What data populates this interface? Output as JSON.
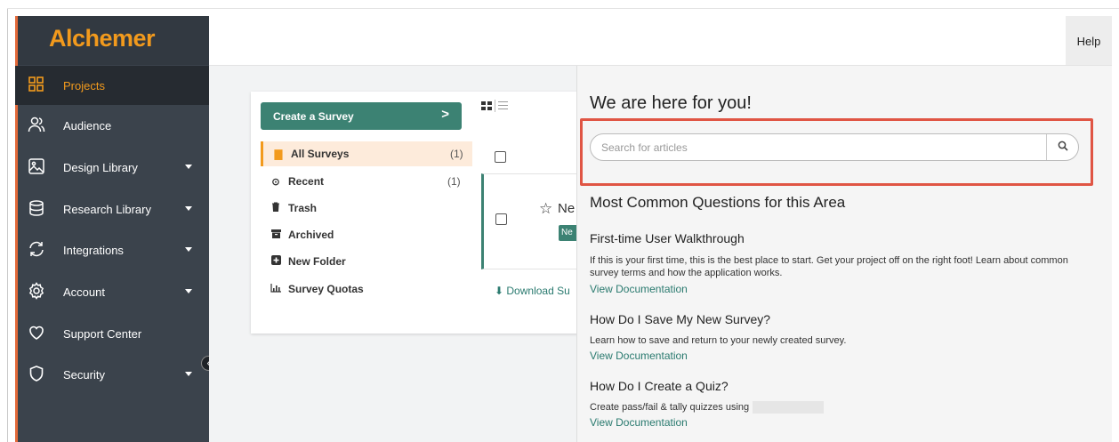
{
  "brand": {
    "logo_text": "Alchemer",
    "accent_color": "#f29a1d",
    "sidebar_color": "#3b434c",
    "primary_green": "#3c8273",
    "highlight_red": "#e05544"
  },
  "sidebar": {
    "items": [
      {
        "label": "Projects",
        "icon": "grid-icon",
        "active": true,
        "has_caret": false
      },
      {
        "label": "Audience",
        "icon": "people-icon",
        "active": false,
        "has_caret": false
      },
      {
        "label": "Design Library",
        "icon": "image-icon",
        "active": false,
        "has_caret": true
      },
      {
        "label": "Research Library",
        "icon": "database-icon",
        "active": false,
        "has_caret": true
      },
      {
        "label": "Integrations",
        "icon": "sync-icon",
        "active": false,
        "has_caret": true
      },
      {
        "label": "Account",
        "icon": "gear-icon",
        "active": false,
        "has_caret": true
      },
      {
        "label": "Support Center",
        "icon": "heart-icon",
        "active": false,
        "has_caret": false
      },
      {
        "label": "Security",
        "icon": "shield-icon",
        "active": false,
        "has_caret": true
      }
    ],
    "collapse_glyph": "‹"
  },
  "header": {
    "help_label": "Help"
  },
  "projects": {
    "create_label": "Create a Survey",
    "create_arrow": ">",
    "folders": [
      {
        "name": "All Surveys",
        "count": "(1)",
        "icon": "file-icon",
        "glyph": "▇",
        "active": true
      },
      {
        "name": "Recent",
        "count": "(1)",
        "icon": "clock-icon",
        "glyph": "⊙",
        "active": false
      },
      {
        "name": "Trash",
        "count": "",
        "icon": "trash-icon",
        "glyph": "🗑",
        "active": false
      },
      {
        "name": "Archived",
        "count": "",
        "icon": "archive-icon",
        "glyph": "▤",
        "active": false
      },
      {
        "name": "New Folder",
        "count": "",
        "icon": "plus-square-icon",
        "glyph": "⊞",
        "active": false
      },
      {
        "name": "Survey Quotas",
        "count": "",
        "icon": "bar-chart-icon",
        "glyph": "lıl",
        "active": false
      }
    ],
    "tile": {
      "star": "☆",
      "name": "Ne",
      "badge": "Ne"
    },
    "download_label": "⬇ Download Su"
  },
  "help_panel": {
    "title": "We are here for you!",
    "search": {
      "placeholder": "Search for articles",
      "value": ""
    },
    "section_title": "Most Common Questions for this Area",
    "questions": [
      {
        "title": "First-time User Walkthrough",
        "desc": "If this is your first time, this is the best place to start. Get your project off on the right foot! Learn about common survey terms and how the application works.",
        "link": "View Documentation"
      },
      {
        "title": "How Do I Save My New Survey?",
        "desc": "Learn how to save and return to your newly created survey.",
        "link": "View Documentation"
      },
      {
        "title": "How Do I Create a Quiz?",
        "desc": "Create pass/fail & tally quizzes using",
        "link": "View Documentation"
      }
    ]
  }
}
